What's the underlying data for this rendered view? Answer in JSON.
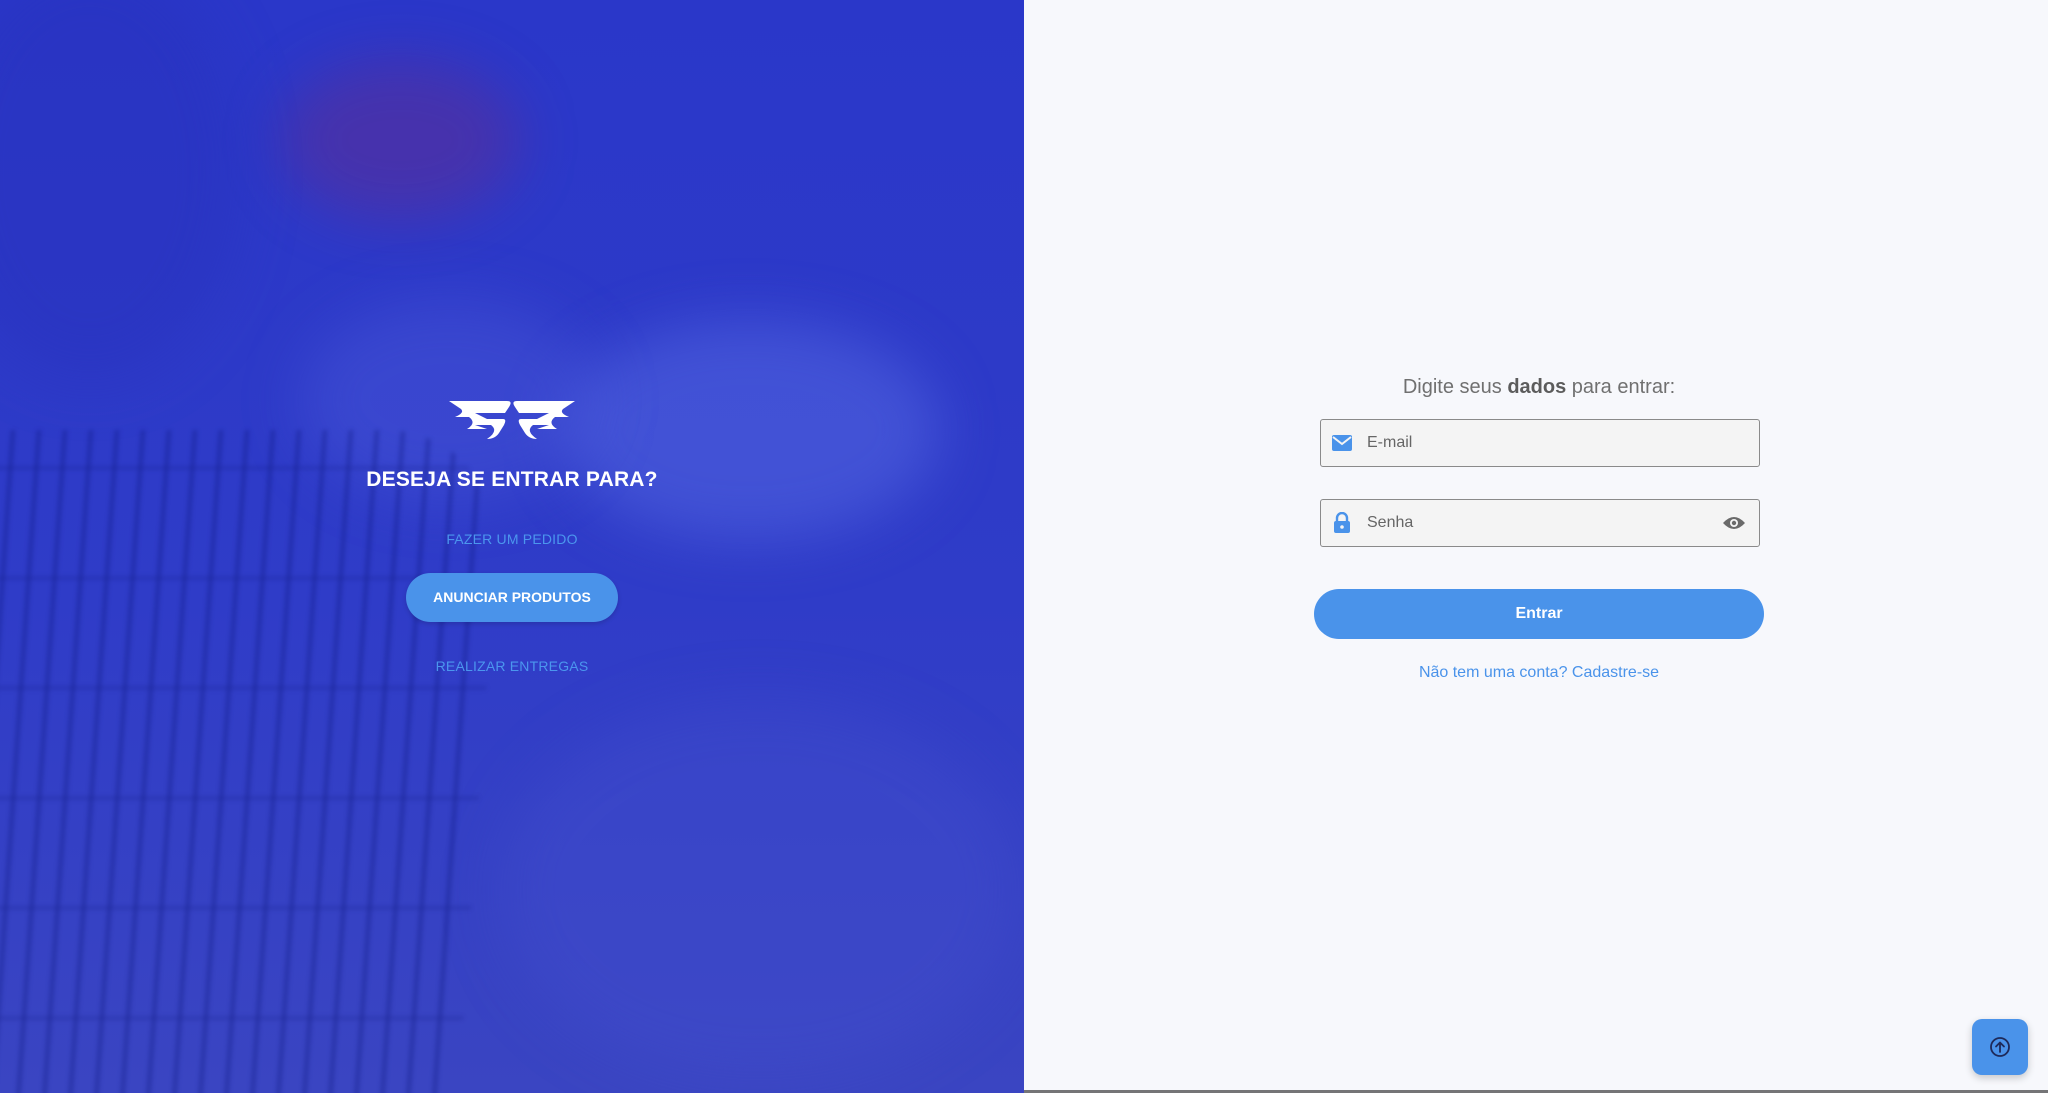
{
  "left_panel": {
    "heading": "DESEJA SE ENTRAR PARA?",
    "roles": [
      {
        "label": "FAZER UM PEDIDO",
        "selected": false
      },
      {
        "label": "ANUNCIAR PRODUTOS",
        "selected": true
      },
      {
        "label": "REALIZAR ENTREGAS",
        "selected": false
      }
    ],
    "logo_icon": "wings-logo-icon",
    "background_color": "#2f3cc8"
  },
  "login": {
    "prompt_pre": "Digite seus ",
    "prompt_bold": "dados",
    "prompt_post": " para entrar:",
    "email_placeholder": "E-mail",
    "email_icon": "mail-icon",
    "password_placeholder": "Senha",
    "password_icon": "lock-icon",
    "visibility_icon": "eye-icon",
    "submit_label": "Entrar",
    "signup_link": "Não tem uma conta? Cadastre-se"
  },
  "fab": {
    "icon": "arrow-up-circle-icon"
  },
  "colors": {
    "accent": "#4a93ea",
    "left_bg": "#2f3cc8",
    "right_bg": "#f7f8fc"
  }
}
